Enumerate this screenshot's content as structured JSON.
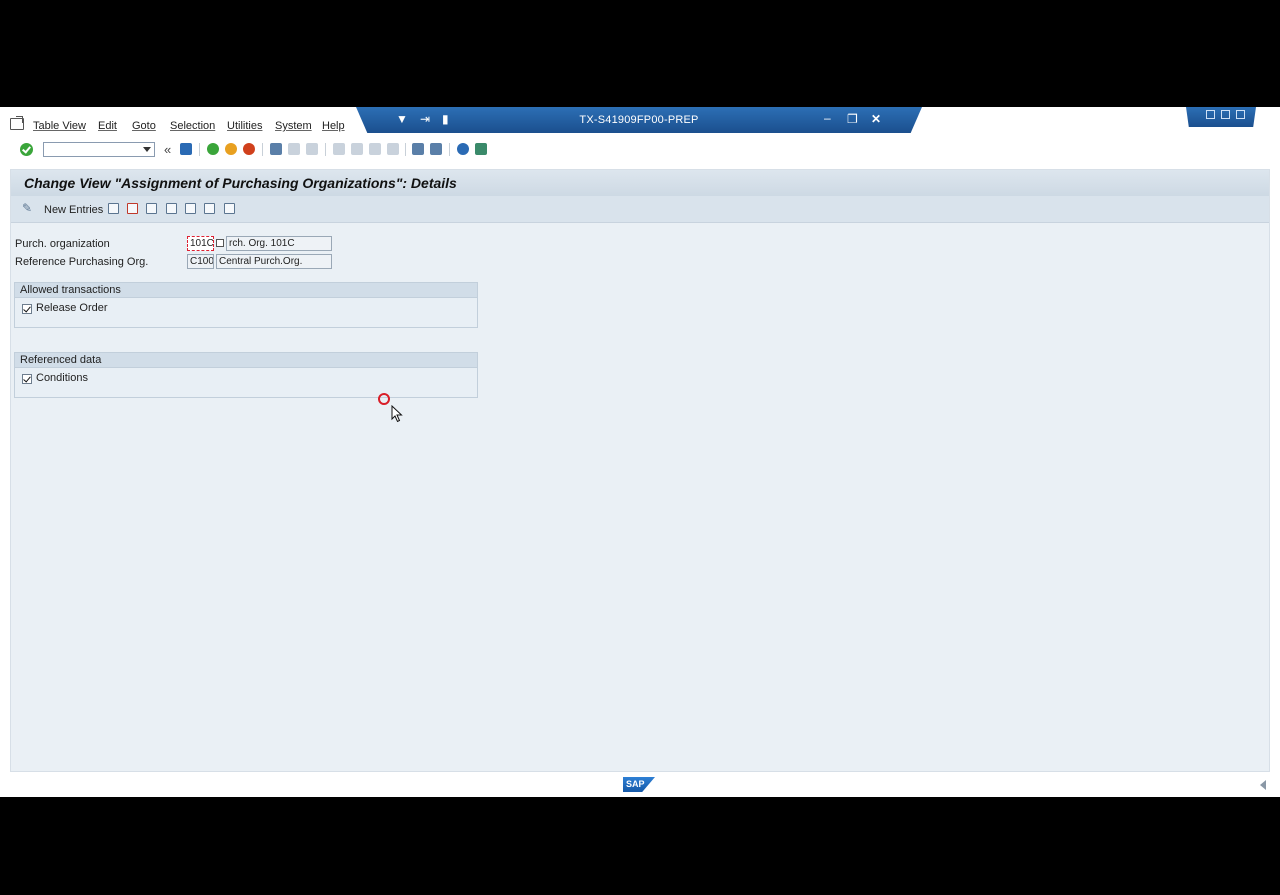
{
  "menu": {
    "items": [
      "Table View",
      "Edit",
      "Goto",
      "Selection",
      "Utilities",
      "System",
      "Help"
    ]
  },
  "window": {
    "title": "TX-S41909FP00-PREP"
  },
  "page": {
    "title": "Change View \"Assignment of Purchasing Organizations\": Details"
  },
  "app_toolbar": {
    "new_entries_label": "New Entries"
  },
  "form": {
    "purch_org_label": "Purch. organization",
    "purch_org_code": "101C",
    "purch_org_desc": "rch. Org. 101C",
    "ref_org_label": "Reference Purchasing Org.",
    "ref_org_code": "C100",
    "ref_org_desc": "Central Purch.Org."
  },
  "groups": {
    "allowed": {
      "title": "Allowed transactions",
      "checkbox_label": "Release Order",
      "checked": true
    },
    "referenced": {
      "title": "Referenced data",
      "checkbox_label": "Conditions",
      "checked": true
    }
  },
  "status": {
    "logo_text": "SAP"
  },
  "colors": {
    "title_band": "#1b4f8e",
    "work_area": "#eaf0f5",
    "ok_green": "#3aa53a",
    "highlight_red": "#d91e28"
  }
}
